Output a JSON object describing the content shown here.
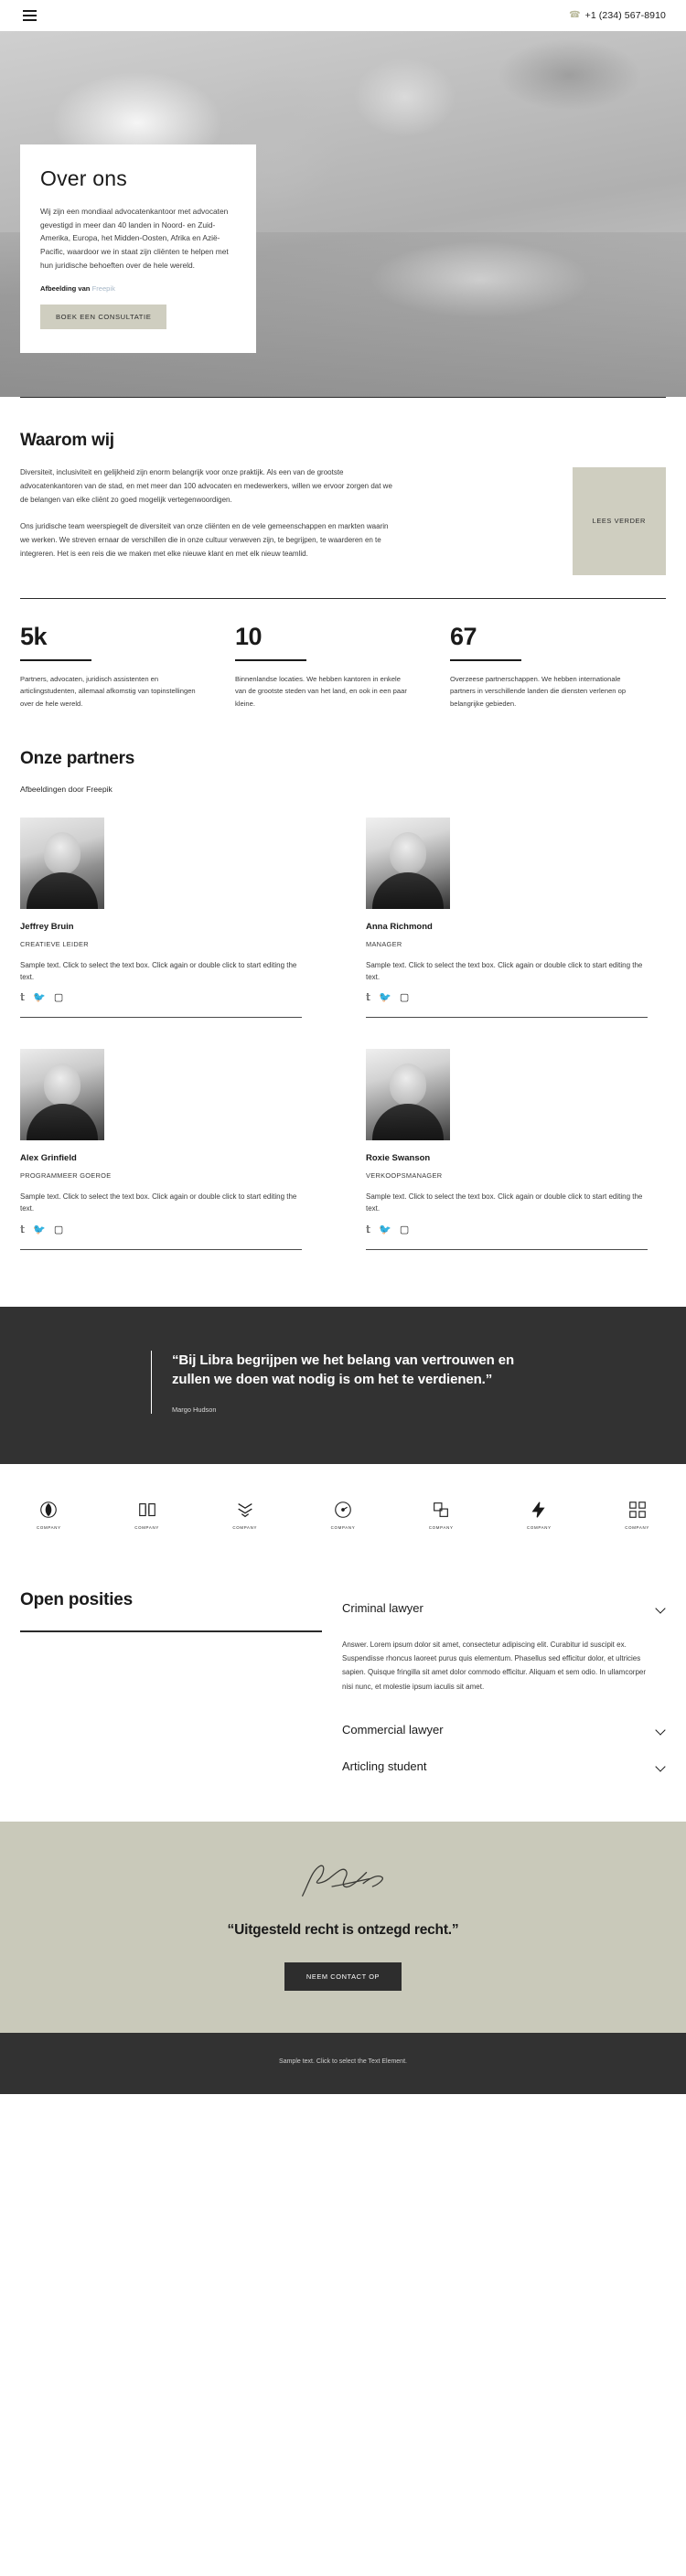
{
  "header": {
    "menu_icon": "hamburger-menu-icon",
    "phone_icon": "phone-icon",
    "phone": "+1 (234) 567-8910"
  },
  "hero": {
    "title": "Over ons",
    "paragraph": "Wij zijn een mondiaal advocatenkantoor met advocaten gevestigd in meer dan 40 landen in Noord- en Zuid-Amerika, Europa, het Midden-Oosten, Afrika en Azië-Pacific, waardoor we in staat zijn cliënten te helpen met hun juridische behoeften over de hele wereld.",
    "credit_label": "Afbeelding van",
    "credit_link": "Freepik",
    "cta_label": "BOEK EEN CONSULTATIE"
  },
  "why": {
    "title": "Waarom wij",
    "paragraph_1": "Diversiteit, inclusiviteit en gelijkheid zijn enorm belangrijk voor onze praktijk. Als een van de grootste advocatenkantoren van de stad, en met meer dan 100 advocaten en medewerkers, willen we ervoor zorgen dat we de belangen van elke cliënt zo goed mogelijk vertegenwoordigen.",
    "paragraph_2": "Ons juridische team weerspiegelt de diversiteit van onze cliënten en de vele gemeenschappen en markten waarin we werken. We streven ernaar de verschillen die in onze cultuur verweven zijn, te begrijpen, te waarderen en te integreren. Het is een reis die we maken met elke nieuwe klant en met elk nieuw teamlid.",
    "read_more_label": "LEES VERDER"
  },
  "stats": [
    {
      "number": "5k",
      "description": "Partners, advocaten, juridisch assistenten en articlingstudenten, allemaal afkomstig van topinstellingen over de hele wereld."
    },
    {
      "number": "10",
      "description": "Binnenlandse locaties. We hebben kantoren in enkele van de grootste steden van het land, en ook in een paar kleine."
    },
    {
      "number": "67",
      "description": "Overzeese partnerschappen. We hebben internationale partners in verschillende landen die diensten verlenen op belangrijke gebieden."
    }
  ],
  "partners": {
    "title": "Onze partners",
    "subtitle": "Afbeeldingen door Freepik",
    "members": [
      {
        "name": "Jeffrey Bruin",
        "role": "CREATIEVE LEIDER",
        "description": "Sample text. Click to select the text box. Click again or double click to start editing the text.",
        "socials": [
          "facebook-icon",
          "twitter-icon",
          "instagram-icon"
        ]
      },
      {
        "name": "Anna Richmond",
        "role": "MANAGER",
        "description": "Sample text. Click to select the text box. Click again or double click to start editing the text.",
        "socials": [
          "facebook-icon",
          "twitter-icon",
          "instagram-icon"
        ]
      },
      {
        "name": "Alex Grinfield",
        "role": "PROGRAMMEER GOEROE",
        "description": "Sample text. Click to select the text box. Click again or double click to start editing the text.",
        "socials": [
          "facebook-icon",
          "twitter-icon",
          "instagram-icon"
        ]
      },
      {
        "name": "Roxie Swanson",
        "role": "VERKOOPSMANAGER",
        "description": "Sample text. Click to select the text box. Click again or double click to start editing the text.",
        "socials": [
          "facebook-icon",
          "twitter-icon",
          "instagram-icon"
        ]
      }
    ]
  },
  "quote": {
    "text": "“Bij Libra begrijpen we het belang van vertrouwen en zullen we doen wat nodig is om het te verdienen.”",
    "author": "Margo Hudson"
  },
  "logos": [
    {
      "label": "COMPANY",
      "icon": "circle-leaf-logo-icon"
    },
    {
      "label": "COMPANY",
      "icon": "open-book-logo-icon"
    },
    {
      "label": "COMPANY",
      "icon": "chevron-stack-logo-icon"
    },
    {
      "label": "COMPANY",
      "icon": "clock-circle-logo-icon"
    },
    {
      "label": "COMPANY",
      "icon": "squares-overlap-logo-icon"
    },
    {
      "label": "COMPANY",
      "icon": "lightning-bolt-logo-icon"
    },
    {
      "label": "COMPANY",
      "icon": "grid-blocks-logo-icon"
    }
  ],
  "faq": {
    "title": "Open posities",
    "items": [
      {
        "question": "Criminal lawyer",
        "answer": "Answer. Lorem ipsum dolor sit amet, consectetur adipiscing elit. Curabitur id suscipit ex. Suspendisse rhoncus laoreet purus quis elementum. Phasellus sed efficitur dolor, et ultricies sapien. Quisque fringilla sit amet dolor commodo efficitur. Aliquam et sem odio. In ullamcorper nisi nunc, et molestie ipsum iaculis sit amet.",
        "expanded": true
      },
      {
        "question": "Commercial lawyer",
        "answer": "",
        "expanded": false
      },
      {
        "question": "Articling student",
        "answer": "",
        "expanded": false
      }
    ]
  },
  "cta": {
    "signature_icon": "handwritten-signature-icon",
    "title": "“Uitgesteld recht is ontzegd recht.”",
    "button_label": "NEEM CONTACT OP"
  },
  "footer": {
    "text": "Sample text. Click to select the Text Element."
  },
  "colors": {
    "accent_tan": "#cfcec0",
    "dark_band": "#323232",
    "cta_band": "#c9c9ba",
    "link_blue": "#a8b8c8"
  }
}
